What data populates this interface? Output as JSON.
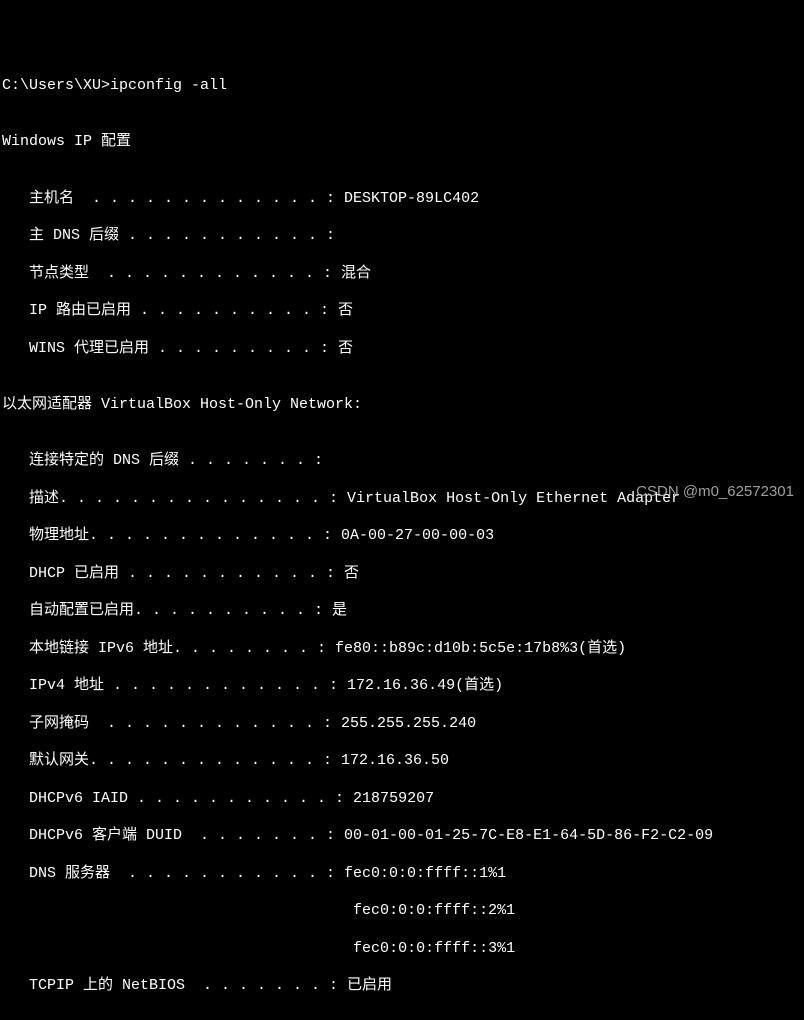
{
  "prompt_line": "C:\\Users\\XU>ipconfig -all",
  "blank": "",
  "header1": "Windows IP 配置",
  "hostcfg": {
    "hostname": "   主机名  . . . . . . . . . . . . . : DESKTOP-89LC402",
    "dns_suffix": "   主 DNS 后缀 . . . . . . . . . . . :",
    "node_type": "   节点类型  . . . . . . . . . . . . : 混合",
    "ip_routing": "   IP 路由已启用 . . . . . . . . . . : 否",
    "wins_proxy": "   WINS 代理已启用 . . . . . . . . . : 否"
  },
  "adapter_header": "以太网适配器 VirtualBox Host-Only Network:",
  "adapter": {
    "conn_dns": "   连接特定的 DNS 后缀 . . . . . . . :",
    "description": "   描述. . . . . . . . . . . . . . . : VirtualBox Host-Only Ethernet Adapter",
    "phys_addr": "   物理地址. . . . . . . . . . . . . : 0A-00-27-00-00-03",
    "dhcp": "   DHCP 已启用 . . . . . . . . . . . : 否",
    "autoconf": "   自动配置已启用. . . . . . . . . . : 是",
    "link_ipv6": "   本地链接 IPv6 地址. . . . . . . . : fe80::b89c:d10b:5c5e:17b8%3(首选)",
    "ipv4": "   IPv4 地址 . . . . . . . . . . . . : 172.16.36.49(首选)",
    "subnet": "   子网掩码  . . . . . . . . . . . . : 255.255.255.240",
    "gateway": "   默认网关. . . . . . . . . . . . . : 172.16.36.50",
    "iaid": "   DHCPv6 IAID . . . . . . . . . . . : 218759207",
    "duid": "   DHCPv6 客户端 DUID  . . . . . . . : 00-01-00-01-25-7C-E8-E1-64-5D-86-F2-C2-09",
    "dns1": "   DNS 服务器  . . . . . . . . . . . : fec0:0:0:ffff::1%1",
    "dns2": "                                       fec0:0:0:ffff::2%1",
    "dns3": "                                       fec0:0:0:ffff::3%1",
    "netbios": "   TCPIP 上的 NetBIOS  . . . . . . . : 已启用"
  },
  "watermark": "CSDN @m0_62572301"
}
